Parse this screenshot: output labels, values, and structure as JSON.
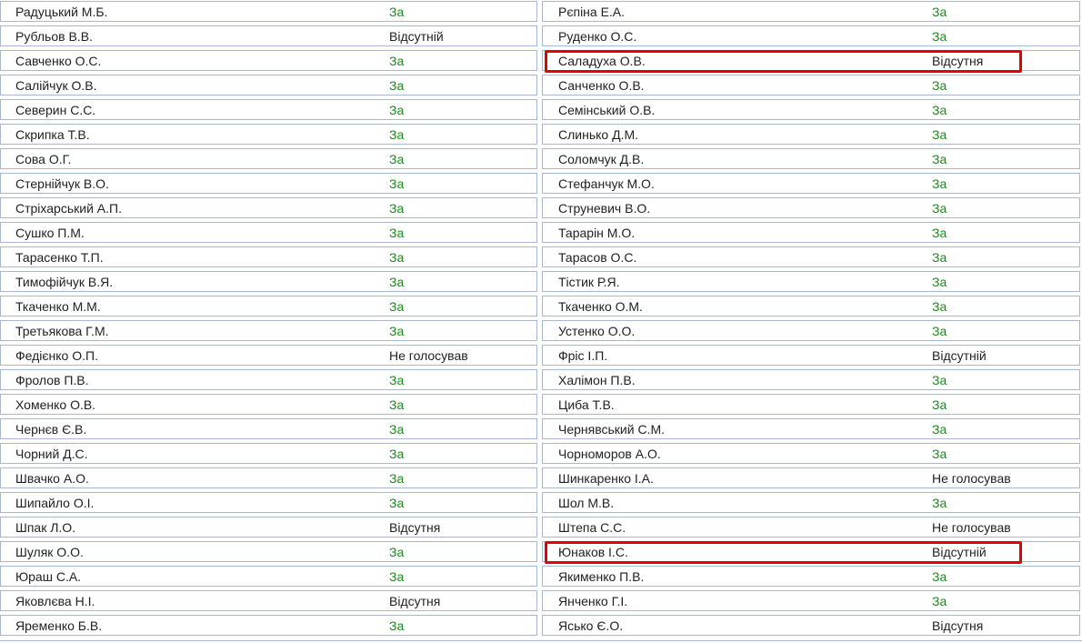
{
  "left": [
    {
      "name": "Радуцький М.Б.",
      "result": "За"
    },
    {
      "name": "Рубльов В.В.",
      "result": "Відсутній"
    },
    {
      "name": "Савченко О.С.",
      "result": "За"
    },
    {
      "name": "Салійчук О.В.",
      "result": "За"
    },
    {
      "name": "Северин С.С.",
      "result": "За"
    },
    {
      "name": "Скрипка Т.В.",
      "result": "За"
    },
    {
      "name": "Сова О.Г.",
      "result": "За"
    },
    {
      "name": "Стернійчук В.О.",
      "result": "За"
    },
    {
      "name": "Стріхарський А.П.",
      "result": "За"
    },
    {
      "name": "Сушко П.М.",
      "result": "За"
    },
    {
      "name": "Тарасенко Т.П.",
      "result": "За"
    },
    {
      "name": "Тимофійчук В.Я.",
      "result": "За"
    },
    {
      "name": "Ткаченко М.М.",
      "result": "За"
    },
    {
      "name": "Третьякова Г.М.",
      "result": "За"
    },
    {
      "name": "Федієнко О.П.",
      "result": "Не голосував"
    },
    {
      "name": "Фролов П.В.",
      "result": "За"
    },
    {
      "name": "Хоменко О.В.",
      "result": "За"
    },
    {
      "name": "Чернєв Є.В.",
      "result": "За"
    },
    {
      "name": "Чорний Д.С.",
      "result": "За"
    },
    {
      "name": "Швачко А.О.",
      "result": "За"
    },
    {
      "name": "Шипайло О.І.",
      "result": "За"
    },
    {
      "name": "Шпак Л.О.",
      "result": "Відсутня"
    },
    {
      "name": "Шуляк О.О.",
      "result": "За"
    },
    {
      "name": "Юраш С.А.",
      "result": "За"
    },
    {
      "name": "Яковлєва Н.І.",
      "result": "Відсутня"
    },
    {
      "name": "Яременко Б.В.",
      "result": "За"
    }
  ],
  "right": [
    {
      "name": "Рєпіна Е.А.",
      "result": "За"
    },
    {
      "name": "Руденко О.С.",
      "result": "За"
    },
    {
      "name": "Саладуха О.В.",
      "result": "Відсутня",
      "highlighted": true
    },
    {
      "name": "Санченко О.В.",
      "result": "За"
    },
    {
      "name": "Семінський О.В.",
      "result": "За"
    },
    {
      "name": "Слинько Д.М.",
      "result": "За"
    },
    {
      "name": "Соломчук Д.В.",
      "result": "За"
    },
    {
      "name": "Стефанчук М.О.",
      "result": "За"
    },
    {
      "name": "Струневич В.О.",
      "result": "За"
    },
    {
      "name": "Тарарін М.О.",
      "result": "За"
    },
    {
      "name": "Тарасов О.С.",
      "result": "За"
    },
    {
      "name": "Тістик Р.Я.",
      "result": "За"
    },
    {
      "name": "Ткаченко О.М.",
      "result": "За"
    },
    {
      "name": "Устенко О.О.",
      "result": "За"
    },
    {
      "name": "Фріс І.П.",
      "result": "Відсутній"
    },
    {
      "name": "Халімон П.В.",
      "result": "За"
    },
    {
      "name": "Циба Т.В.",
      "result": "За"
    },
    {
      "name": "Чернявський С.М.",
      "result": "За"
    },
    {
      "name": "Чорноморов А.О.",
      "result": "За"
    },
    {
      "name": "Шинкаренко І.А.",
      "result": "Не голосував"
    },
    {
      "name": "Шол М.В.",
      "result": "За"
    },
    {
      "name": "Штепа С.С.",
      "result": "Не голосував"
    },
    {
      "name": "Юнаков І.С.",
      "result": "Відсутній",
      "highlighted": true
    },
    {
      "name": "Якименко П.В.",
      "result": "За"
    },
    {
      "name": "Янченко Г.І.",
      "result": "За"
    },
    {
      "name": "Ясько Є.О.",
      "result": "Відсутня"
    }
  ],
  "colors": {
    "vote_yes": "#1c8a1c",
    "vote_other": "#222222",
    "row_border": "#a9b8cc",
    "highlight": "#e60000"
  }
}
